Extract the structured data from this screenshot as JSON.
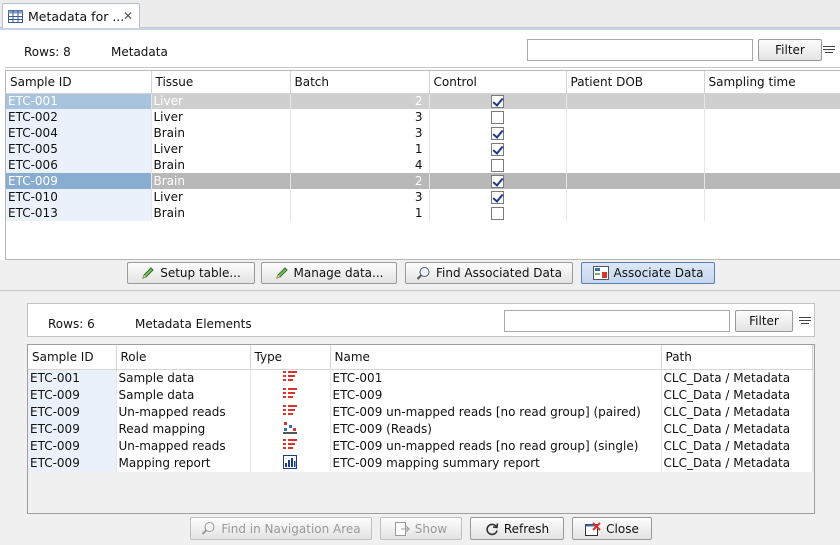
{
  "tab": {
    "title": "Metadata for ...",
    "icon": "table-icon",
    "close_icon": "close-icon"
  },
  "top": {
    "rows_label": "Rows: 8",
    "section_title": "Metadata",
    "filter_value": "",
    "filter_button": "Filter",
    "columns": [
      "Sample ID",
      "Tissue",
      "Batch",
      "Control",
      "Patient DOB",
      "Sampling time"
    ],
    "rows": [
      {
        "id": "ETC-001",
        "tissue": "Liver",
        "batch": "2",
        "control": true
      },
      {
        "id": "ETC-002",
        "tissue": "Liver",
        "batch": "3",
        "control": false
      },
      {
        "id": "ETC-004",
        "tissue": "Brain",
        "batch": "3",
        "control": true
      },
      {
        "id": "ETC-005",
        "tissue": "Liver",
        "batch": "1",
        "control": true
      },
      {
        "id": "ETC-006",
        "tissue": "Brain",
        "batch": "4",
        "control": false
      },
      {
        "id": "ETC-009",
        "tissue": "Brain",
        "batch": "2",
        "control": true
      },
      {
        "id": "ETC-010",
        "tissue": "Liver",
        "batch": "3",
        "control": true
      },
      {
        "id": "ETC-013",
        "tissue": "Brain",
        "batch": "1",
        "control": false
      }
    ]
  },
  "actions": {
    "setup_table": "Setup table...",
    "manage_data": "Manage data...",
    "find_associated": "Find Associated Data",
    "associate_data": "Associate Data"
  },
  "bottom": {
    "rows_label": "Rows: 6",
    "section_title": "Metadata Elements",
    "filter_value": "",
    "filter_button": "Filter",
    "columns": [
      "Sample ID",
      "Role",
      "Type",
      "Name",
      "Path"
    ],
    "rows": [
      {
        "id": "ETC-001",
        "role": "Sample data",
        "type": "sequence-list-icon",
        "name": "ETC-001",
        "path": "CLC_Data / Metadata"
      },
      {
        "id": "ETC-009",
        "role": "Sample data",
        "type": "sequence-list-icon",
        "name": "ETC-009",
        "path": "CLC_Data / Metadata"
      },
      {
        "id": "ETC-009",
        "role": "Un-mapped reads",
        "type": "sequence-list-icon",
        "name": "ETC-009 un-mapped reads [no read group] (paired)",
        "path": "CLC_Data / Metadata"
      },
      {
        "id": "ETC-009",
        "role": "Read mapping",
        "type": "read-mapping-icon",
        "name": "ETC-009 (Reads)",
        "path": "CLC_Data / Metadata"
      },
      {
        "id": "ETC-009",
        "role": "Un-mapped reads",
        "type": "sequence-list-icon",
        "name": "ETC-009 un-mapped reads [no read group] (single)",
        "path": "CLC_Data / Metadata"
      },
      {
        "id": "ETC-009",
        "role": "Mapping report",
        "type": "report-icon",
        "name": "ETC-009 mapping summary report",
        "path": "CLC_Data / Metadata"
      }
    ],
    "buttons": {
      "find_nav": "Find in Navigation Area",
      "show": "Show",
      "refresh": "Refresh",
      "close": "Close"
    }
  },
  "colors": {
    "accent_red": "#d9342b",
    "accent_blue": "#1b3a8c",
    "selection": "#a8c3dd"
  }
}
